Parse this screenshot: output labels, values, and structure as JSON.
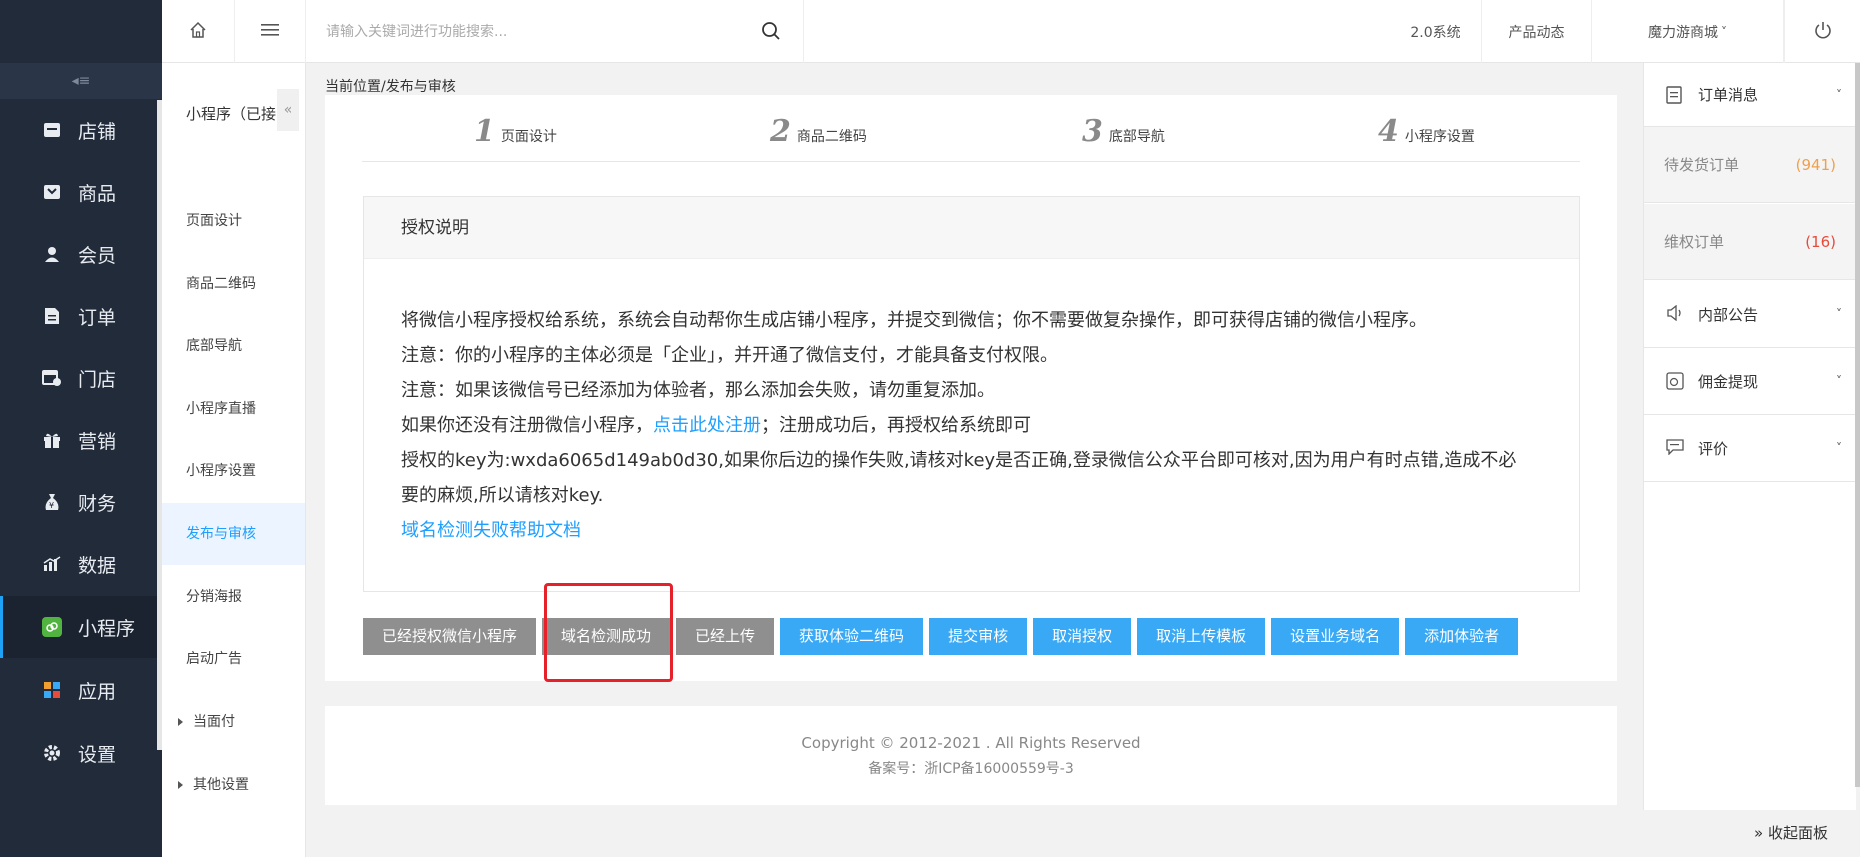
{
  "sidebar": {
    "collapse_glyph": "◂≡",
    "items": [
      {
        "label": "店铺",
        "icon": "shop-icon"
      },
      {
        "label": "商品",
        "icon": "goods-icon"
      },
      {
        "label": "会员",
        "icon": "member-icon"
      },
      {
        "label": "订单",
        "icon": "order-icon"
      },
      {
        "label": "门店",
        "icon": "store-icon"
      },
      {
        "label": "营销",
        "icon": "gift-icon"
      },
      {
        "label": "财务",
        "icon": "money-bag-icon"
      },
      {
        "label": "数据",
        "icon": "chart-icon"
      },
      {
        "label": "小程序",
        "icon": "miniprogram-icon",
        "active": true
      },
      {
        "label": "应用",
        "icon": "apps-icon"
      },
      {
        "label": "设置",
        "icon": "gear-icon"
      }
    ]
  },
  "submenu": {
    "title": "小程序（已接",
    "fold_glyph": "«",
    "items": [
      {
        "label": "页面设计"
      },
      {
        "label": "商品二维码"
      },
      {
        "label": "底部导航"
      },
      {
        "label": "小程序直播"
      },
      {
        "label": "小程序设置"
      },
      {
        "label": "发布与审核",
        "active": true
      },
      {
        "label": "分销海报"
      },
      {
        "label": "启动广告"
      },
      {
        "label": "当面付",
        "expandable": true
      },
      {
        "label": "其他设置",
        "expandable": true
      }
    ]
  },
  "topbar": {
    "search_placeholder": "请输入关键词进行功能搜索...",
    "version": "2.0系统",
    "news": "产品动态",
    "shop": "魔力游商城",
    "shop_caret": "˅"
  },
  "breadcrumb": "当前位置/发布与审核",
  "steps": [
    {
      "num": "1",
      "label": "页面设计"
    },
    {
      "num": "2",
      "label": "商品二维码"
    },
    {
      "num": "3",
      "label": "底部导航"
    },
    {
      "num": "4",
      "label": "小程序设置"
    }
  ],
  "auth": {
    "title": "授权说明",
    "line1": "将微信小程序授权给系统，系统会自动帮你生成店铺小程序，并提交到微信；你不需要做复杂操作，即可获得店铺的微信小程序。",
    "line2": "注意：你的小程序的主体必须是「企业」，并开通了微信支付，才能具备支付权限。",
    "line3": "注意：如果该微信号已经添加为体验者，那么添加会失败，请勿重复添加。",
    "line4_pre": "如果你还没有注册微信小程序，",
    "line4_link": "点击此处注册",
    "line4_post": "；注册成功后，再授权给系统即可",
    "line5": "授权的key为:wxda6065d149ab0d30,如果你后边的操作失败,请核对key是否正确,登录微信公众平台即可核对,因为用户有时点错,造成不必",
    "line6": "要的麻烦,所以请核对key.",
    "help_link": "域名检测失败帮助文档"
  },
  "buttons": [
    {
      "label": "已经授权微信小程序",
      "style": "grey"
    },
    {
      "label": "域名检测成功",
      "style": "grey"
    },
    {
      "label": "已经上传",
      "style": "grey"
    },
    {
      "label": "获取体验二维码",
      "style": "blue"
    },
    {
      "label": "提交审核",
      "style": "blue"
    },
    {
      "label": "取消授权",
      "style": "blue"
    },
    {
      "label": "取消上传模板",
      "style": "blue"
    },
    {
      "label": "设置业务域名",
      "style": "blue"
    },
    {
      "label": "添加体验者",
      "style": "blue"
    }
  ],
  "footer": {
    "copyright": "Copyright © 2012-2021 . All Rights Reserved",
    "icp": "备案号：浙ICP备16000559号-3"
  },
  "right_panel": {
    "order_msg": "订单消息",
    "pending_ship": "待发货订单",
    "pending_ship_count": "(941)",
    "rights_order": "维权订单",
    "rights_order_count": "(16)",
    "notice": "内部公告",
    "commission": "佣金提现",
    "review": "评价",
    "collapse": "» 收起面板",
    "chevron": "˅"
  },
  "colors": {
    "sidebar_bg": "#222b3a",
    "accent_blue": "#3aa9f5",
    "grey_button": "#8f8f8f",
    "highlight_red": "#e6212a"
  }
}
